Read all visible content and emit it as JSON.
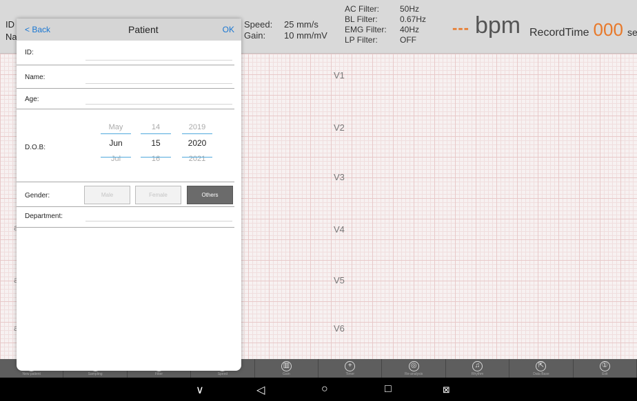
{
  "header": {
    "id_label": "ID",
    "name_label": "Na",
    "speed_label": "Speed:",
    "speed_value": "25 mm/s",
    "gain_label": "Gain:",
    "gain_value": "10 mm/mV",
    "ac_filter_label": "AC Filter:",
    "ac_filter_value": "50Hz",
    "bl_filter_label": "BL Filter:",
    "bl_filter_value": "0.67Hz",
    "emg_filter_label": "EMG Filter:",
    "emg_filter_value": "40Hz",
    "lp_filter_label": "LP Filter:",
    "lp_filter_value": "OFF",
    "bpm_dashes": "---",
    "bpm_unit": "bpm",
    "record_time_label": "RecordTime",
    "record_time_value": "000",
    "record_time_unit": "sec",
    "accent_color": "#e8792a"
  },
  "leads": [
    "V1",
    "V2",
    "V3",
    "V4",
    "V5",
    "V6"
  ],
  "left_marks": [
    "a",
    "a",
    "a"
  ],
  "patient_panel": {
    "back_label": "< Back",
    "title": "Patient",
    "ok_label": "OK",
    "id_label": "ID:",
    "name_label": "Name:",
    "age_label": "Age:",
    "dob_label": "D.O.B:",
    "dob": {
      "month_prev": "May",
      "month": "Jun",
      "month_next": "Jul",
      "day_prev": "14",
      "day": "15",
      "day_next": "16",
      "year_prev": "2019",
      "year": "2020",
      "year_next": "2021"
    },
    "gender_label": "Gender:",
    "gender_options": [
      "Male",
      "Female",
      "Others"
    ],
    "gender_selected": "Others",
    "department_label": "Department:"
  },
  "toolbar": {
    "tools": [
      {
        "icon": "circle-icon",
        "glyph": "",
        "label": "New patient"
      },
      {
        "icon": "circle-icon",
        "glyph": "",
        "label": "Sampling"
      },
      {
        "icon": "circle-icon",
        "glyph": "",
        "label": "Filter"
      },
      {
        "icon": "circle-icon",
        "glyph": "",
        "label": "Speed"
      },
      {
        "icon": "bar-chart-icon",
        "glyph": "▥",
        "label": "Gain"
      },
      {
        "icon": "plus-icon",
        "glyph": "+",
        "label": "Timer"
      },
      {
        "icon": "record-icon",
        "glyph": "◎",
        "label": "Re-analysis"
      },
      {
        "icon": "music-icon",
        "glyph": "♫",
        "label": "Rhythm"
      },
      {
        "icon": "export-icon",
        "glyph": "⇱",
        "label": "Data Base"
      },
      {
        "icon": "exit-icon",
        "glyph": "①",
        "label": "Exit"
      }
    ]
  },
  "navbar": {
    "chevron": "∨",
    "back": "◁",
    "home": "○",
    "recents": "□",
    "screenshot": "⊠"
  }
}
